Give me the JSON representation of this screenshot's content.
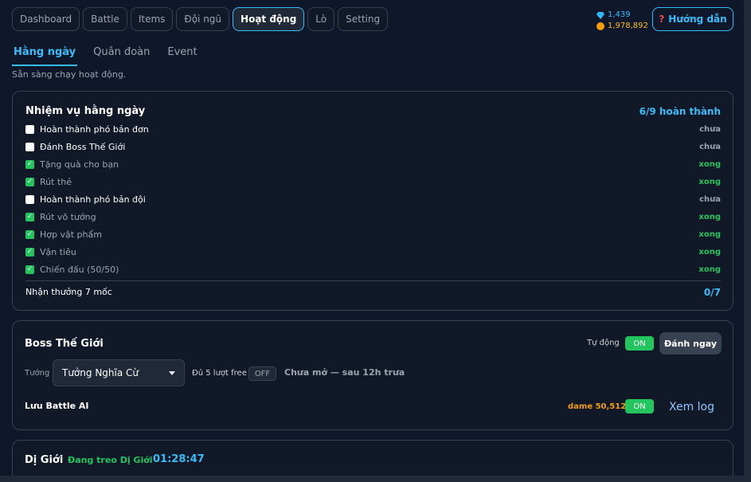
{
  "nav": {
    "tabs": [
      {
        "label": "Dashboard"
      },
      {
        "label": "Battle"
      },
      {
        "label": "Items"
      },
      {
        "label": "Đội ngũ"
      },
      {
        "label": "Hoạt động",
        "active": true
      },
      {
        "label": "Lò"
      },
      {
        "label": "Setting"
      }
    ]
  },
  "currency": {
    "gems": "1,439",
    "gold": "1,978,892"
  },
  "guide": {
    "label": "Hướng dẫn",
    "icon": "?"
  },
  "subtabs": [
    {
      "label": "Hằng ngày",
      "active": true
    },
    {
      "label": "Quân đoàn"
    },
    {
      "label": "Event"
    }
  ],
  "status_text": "Sẵn sàng chạy hoạt động.",
  "daily": {
    "title": "Nhiệm vụ hằng ngày",
    "progress": "6/9 hoàn thành",
    "tasks": [
      {
        "label": "Hoàn thành phó bản đơn",
        "status": "chưa",
        "done": false
      },
      {
        "label": "Đánh Boss Thế Giới",
        "status": "chưa",
        "done": false
      },
      {
        "label": "Tặng quà cho bạn",
        "status": "xong",
        "done": true
      },
      {
        "label": "Rút thẻ",
        "status": "xong",
        "done": true
      },
      {
        "label": "Hoàn thành phó bản đội",
        "status": "chưa",
        "done": false
      },
      {
        "label": "Rút võ tướng",
        "status": "xong",
        "done": true
      },
      {
        "label": "Hợp vật phẩm",
        "status": "xong",
        "done": true
      },
      {
        "label": "Vận tiêu",
        "status": "xong",
        "done": true
      },
      {
        "label": "Chiến đấu (50/50)",
        "status": "xong",
        "done": true
      }
    ],
    "reward_label": "Nhận thưởng 7 mốc",
    "reward_count": "0/7"
  },
  "boss": {
    "title": "Boss Thế Giới",
    "auto_label": "Tự động",
    "auto_toggle": "ON",
    "fight_now": "Đánh ngay",
    "general_label": "Tướng",
    "general_selected": "Tưởng Nghĩa Cừ",
    "free_label": "Đủ 5 lượt free",
    "free_toggle": "OFF",
    "open_info": "Chưa mở — sau 12h trưa",
    "ai_title": "Lưu Battle AI",
    "damage": "dame 50,512",
    "ai_toggle": "ON",
    "view_log": "Xem log"
  },
  "digioi": {
    "title": "Dị Giới",
    "status": "Đang treo Dị Giới",
    "timer": "01:28:47"
  },
  "colors": {
    "accent": "#38bdf8",
    "success": "#22c55e",
    "gold": "#f59e0b",
    "background": "#0f172a",
    "card": "#111827"
  }
}
